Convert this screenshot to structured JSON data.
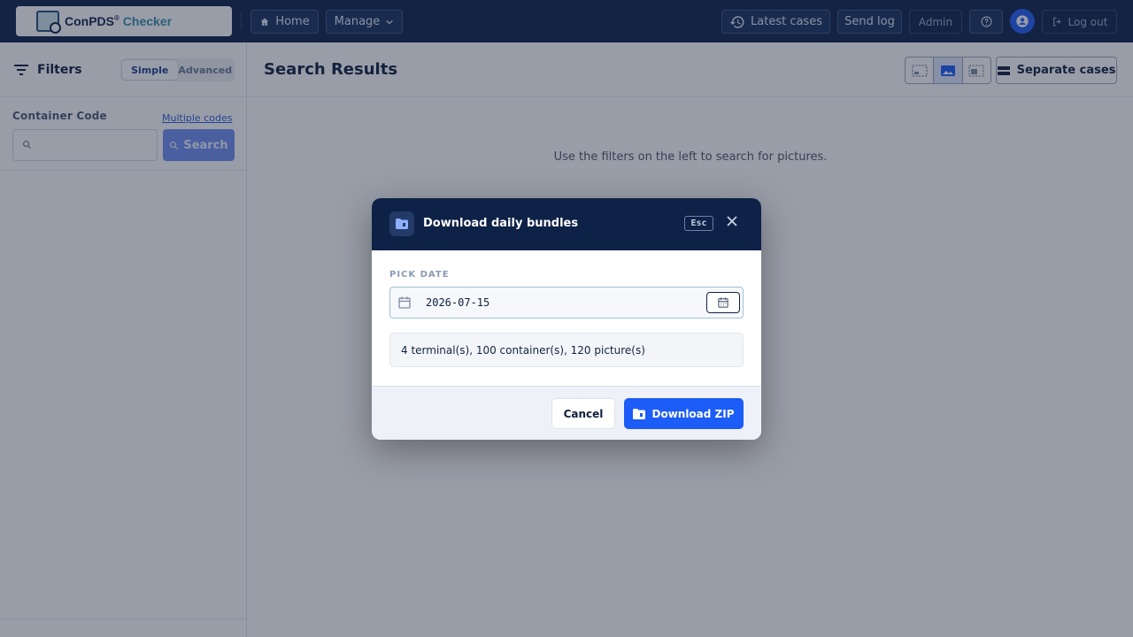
{
  "app": {
    "logo_name": "ConPDS",
    "logo_mark": "®",
    "logo_suffix": "Checker"
  },
  "nav": {
    "home": "Home",
    "manage": "Manage",
    "latest_cases": "Latest cases",
    "send_log": "Send log",
    "admin": "Admin",
    "logout": "Log out"
  },
  "sidebar": {
    "title": "Filters",
    "modes": [
      "Simple",
      "Advanced"
    ],
    "active_mode": "Simple",
    "field_label": "Container Code",
    "multiple_codes_link": "Multiple codes",
    "search_value": "",
    "search_button": "Search"
  },
  "main": {
    "title": "Search Results",
    "separate_cases": "Separate cases",
    "hint": "Use the filters on the left to search for pictures.",
    "active_view": "picture"
  },
  "modal": {
    "title": "Download daily bundles",
    "esc_label": "Esc",
    "pick_date_label": "PICK DATE",
    "date_value": "2026-07-15",
    "summary": "4 terminal(s), 100 container(s), 120 picture(s)",
    "cancel": "Cancel",
    "download": "Download ZIP"
  },
  "colors": {
    "navbar": "#0e2247",
    "primary": "#1c5cf7",
    "overlay": "rgba(28,38,62,0.45)"
  }
}
